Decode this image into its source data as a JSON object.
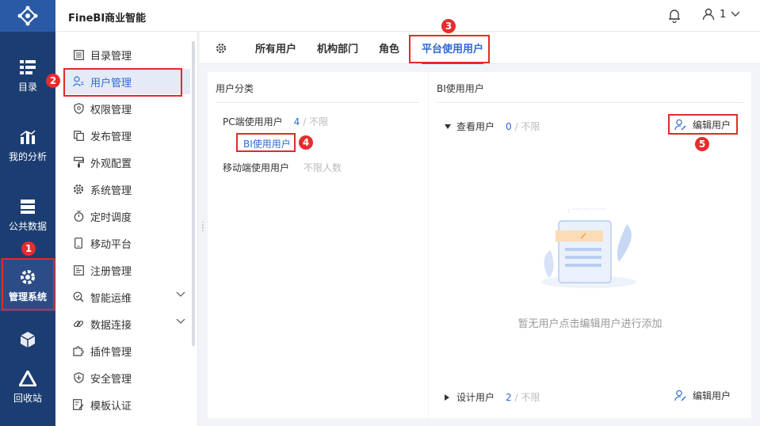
{
  "header": {
    "title": "FineBI商业智能",
    "user_name": "1"
  },
  "rail": {
    "items": [
      {
        "label": "目录"
      },
      {
        "label": "我的分析"
      },
      {
        "label": "公共数据"
      },
      {
        "label": "管理系统"
      },
      {
        "label": ""
      },
      {
        "label": "回收站"
      }
    ]
  },
  "menu": {
    "items": [
      {
        "label": "目录管理"
      },
      {
        "label": "用户管理"
      },
      {
        "label": "权限管理"
      },
      {
        "label": "发布管理"
      },
      {
        "label": "外观配置"
      },
      {
        "label": "系统管理"
      },
      {
        "label": "定时调度"
      },
      {
        "label": "移动平台"
      },
      {
        "label": "注册管理"
      },
      {
        "label": "智能运维"
      },
      {
        "label": "数据连接"
      },
      {
        "label": "插件管理"
      },
      {
        "label": "安全管理"
      },
      {
        "label": "模板认证"
      }
    ]
  },
  "tabs": [
    {
      "label": "所有用户"
    },
    {
      "label": "机构部门"
    },
    {
      "label": "角色"
    },
    {
      "label": "平台使用用户"
    }
  ],
  "left_panel": {
    "title": "用户分类",
    "pc_label": "PC端使用用户",
    "pc_count": "4",
    "pc_limit": "/ 不限",
    "bi_label": "BI使用用户",
    "mobile_label": "移动端使用用户",
    "mobile_limit": "不限人数"
  },
  "right_panel": {
    "title": "BI使用用户",
    "view_label": "查看用户",
    "view_count": "0",
    "view_limit": "/ 不限",
    "edit_label": "编辑用户",
    "empty_text": "暂无用户点击编辑用户进行添加",
    "design_label": "设计用户",
    "design_count": "2",
    "design_limit": "/ 不限",
    "edit_label_2": "编辑用户"
  },
  "annotations": [
    "1",
    "2",
    "3",
    "4",
    "5"
  ],
  "colors": {
    "rail_bg": "#1c3d72",
    "accent": "#2f6ad1",
    "annotation": "#e02b2b"
  }
}
